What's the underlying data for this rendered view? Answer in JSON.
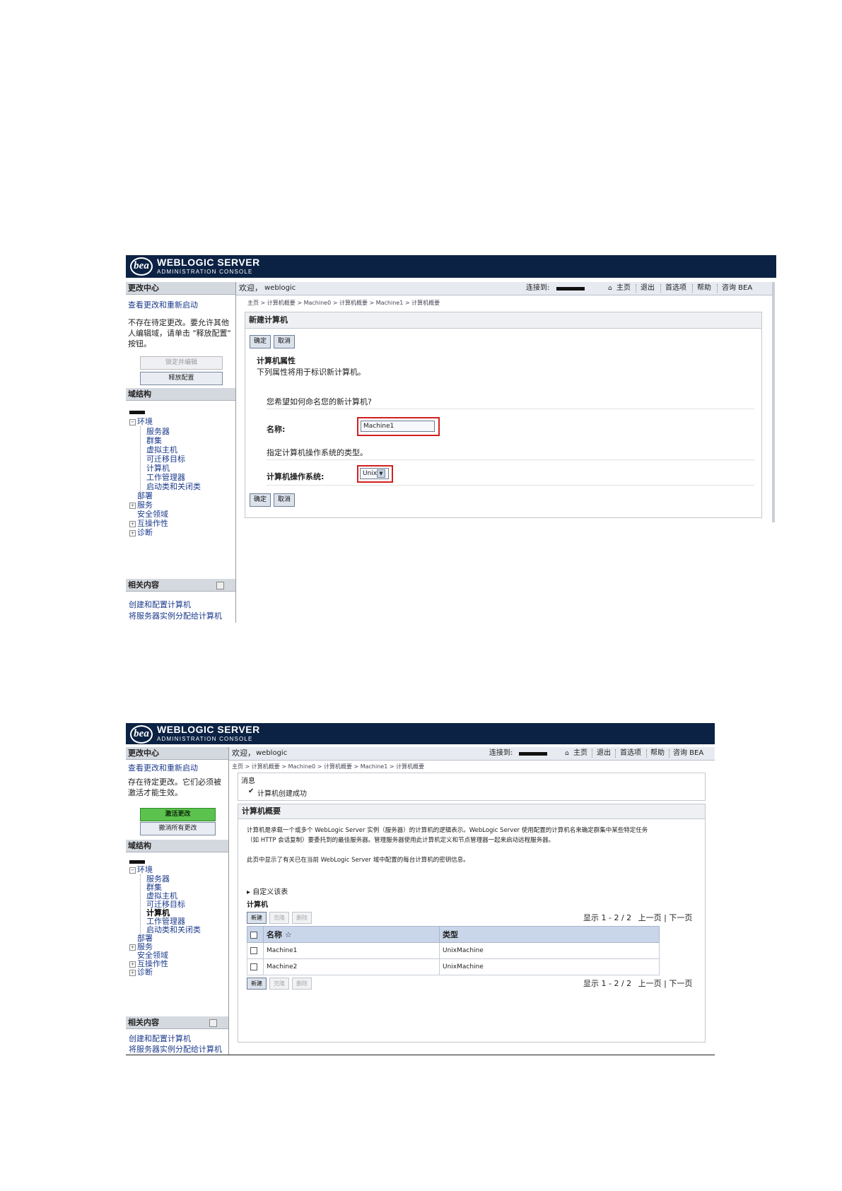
{
  "shot1": {
    "brand": {
      "logo": "bea",
      "title": "WEBLOGIC SERVER",
      "subtitle": "ADMINISTRATION CONSOLE"
    },
    "change_center": {
      "header": "更改中心",
      "view_changes_link": "查看更改和重新启动",
      "status_text": "不存在待定更改。要允许其他人编辑域，请单击 \"释放配置\" 按钮。",
      "btn_lock": "锁定并编辑",
      "btn_release": "释放配置"
    },
    "domain_structure": {
      "header": "域结构",
      "tree": {
        "environment": "环境",
        "servers": "服务器",
        "clusters": "群集",
        "virtual_hosts": "虚拟主机",
        "migratable_targets": "可迁移目标",
        "machines": "计算机",
        "work_managers": "工作管理器",
        "startup_shutdown": "启动类和关闭类",
        "deployments": "部署",
        "services": "服务",
        "security_realms": "安全领域",
        "interoperability": "互操作性",
        "diagnostics": "诊断"
      }
    },
    "related": {
      "header": "相关内容",
      "items": [
        "创建和配置计算机",
        "将服务器实例分配给计算机"
      ]
    },
    "topbar": {
      "welcome_label": "欢迎，",
      "user": "weblogic",
      "connected_label": "连接到:",
      "links": [
        "主页",
        "退出",
        "首选项",
        "帮助",
        "咨询 BEA"
      ]
    },
    "breadcrumb": "主页 > 计算机概要 > Machine0 > 计算机概要 > Machine1 > 计算机概要",
    "form": {
      "title": "新建计算机",
      "ok": "确定",
      "cancel": "取消",
      "section_title": "计算机属性",
      "section_desc": "下列属性将用于标识新计算机。",
      "name_question": "您希望如何命名您的新计算机?",
      "name_label": "名称:",
      "name_value": "Machine1",
      "os_desc": "指定计算机操作系统的类型。",
      "os_label": "计算机操作系统:",
      "os_value": "Unix"
    }
  },
  "shot2": {
    "brand": {
      "logo": "bea",
      "title": "WEBLOGIC SERVER",
      "subtitle": "ADMINISTRATION CONSOLE"
    },
    "change_center": {
      "header": "更改中心",
      "view_changes_link": "查看更改和重新启动",
      "status_text": "存在待定更改。它们必须被激活才能生效。",
      "btn_activate": "激活更改",
      "btn_undo": "撤消所有更改"
    },
    "domain_structure": {
      "header": "域结构",
      "tree": {
        "environment": "环境",
        "servers": "服务器",
        "clusters": "群集",
        "virtual_hosts": "虚拟主机",
        "migratable_targets": "可迁移目标",
        "machines": "计算机",
        "work_managers": "工作管理器",
        "startup_shutdown": "启动类和关闭类",
        "deployments": "部署",
        "services": "服务",
        "security_realms": "安全领域",
        "interoperability": "互操作性",
        "diagnostics": "诊断"
      }
    },
    "related": {
      "header": "相关内容",
      "items": [
        "创建和配置计算机",
        "将服务器实例分配给计算机"
      ]
    },
    "topbar": {
      "welcome_label": "欢迎，",
      "user": "weblogic",
      "connected_label": "连接到:",
      "links": [
        "主页",
        "退出",
        "首选项",
        "帮助",
        "咨询 BEA"
      ]
    },
    "breadcrumb": "主页 > 计算机概要 > Machine0 > 计算机概要 > Machine1 > 计算机概要",
    "messages": {
      "title": "消息",
      "success": "计算机创建成功"
    },
    "summary": {
      "title": "计算机概要",
      "desc1": "计算机是承载一个或多个 WebLogic Server 实例（服务器）的计算机的逻辑表示。WebLogic Server 使用配置的计算机名来确定群集中某些特定任务",
      "desc2": "（如 HTTP 会话复制）要委托到的最佳服务器。管理服务器使用此计算机定义和节点管理器一起来启动远程服务器。",
      "desc3": "此页中显示了有关已在当前 WebLogic Server 域中配置的每台计算机的密钥信息。",
      "customize": "自定义该表",
      "table_title": "计算机",
      "btn_new": "新建",
      "btn_clone": "克隆",
      "btn_delete": "删除",
      "pager_display": "显示 1 - 2 / 2",
      "pager_prev": "上一页",
      "pager_next": "下一页",
      "columns": [
        "名称 ☆",
        "类型"
      ],
      "rows": [
        {
          "name": "Machine1",
          "type": "UnixMachine"
        },
        {
          "name": "Machine2",
          "type": "UnixMachine"
        }
      ]
    }
  }
}
